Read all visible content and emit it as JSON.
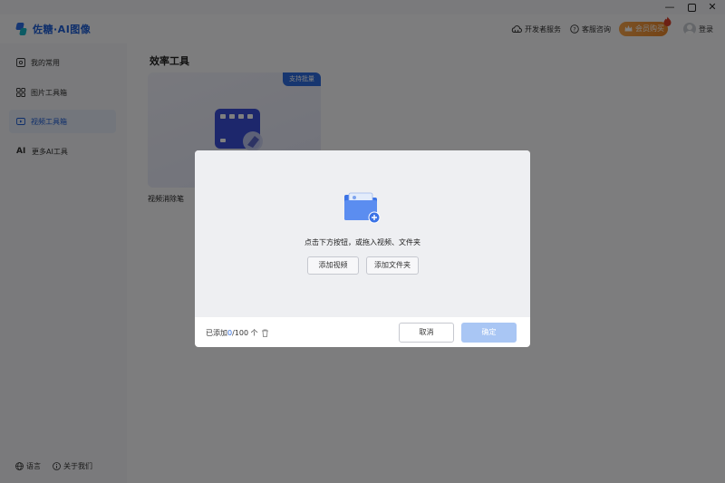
{
  "window": {
    "minimize_icon": "minimize-icon",
    "maximize_icon": "maximize-icon",
    "close_icon": "close-icon"
  },
  "header": {
    "logo_text": "佐糖·AI图像",
    "developer_service": "开发者服务",
    "customer_service": "客服咨询",
    "vip_purchase": "会员购买",
    "login": "登录"
  },
  "sidebar": {
    "items": [
      {
        "label": "我的常用",
        "icon": "home-icon"
      },
      {
        "label": "图片工具箱",
        "icon": "grid-icon"
      },
      {
        "label": "视频工具箱",
        "icon": "video-icon",
        "active": true
      },
      {
        "label": "更多AI工具",
        "icon": "ai-icon"
      }
    ],
    "footer": {
      "language": "语言",
      "about": "关于我们"
    }
  },
  "main": {
    "section_title": "效率工具",
    "card": {
      "badge": "支持批量",
      "label": "视频消除笔"
    }
  },
  "modal": {
    "hint": "点击下方按钮，或拖入视频、文件夹",
    "add_video": "添加视频",
    "add_folder": "添加文件夹",
    "count_prefix": "已添加 ",
    "count_value": "0",
    "count_suffix": "/100 个",
    "cancel": "取消",
    "confirm": "确定"
  },
  "colors": {
    "accent": "#2f6de0",
    "confirm_disabled": "#a9c6f4",
    "vip": "#e8862a"
  }
}
